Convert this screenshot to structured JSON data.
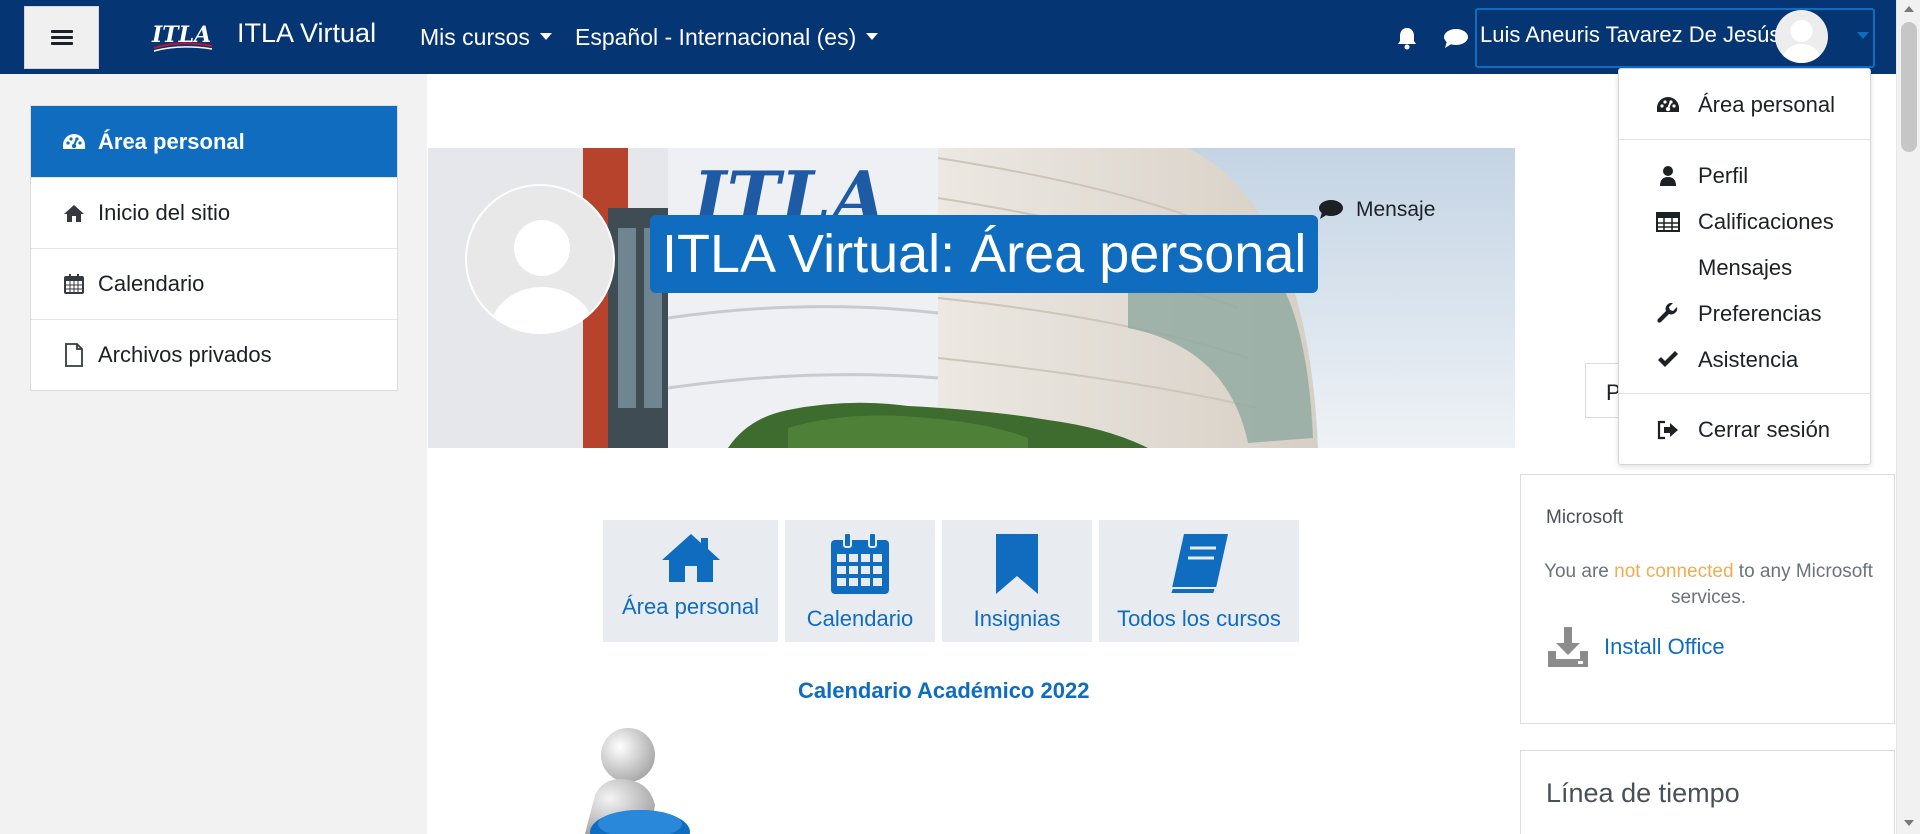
{
  "navbar": {
    "site_name": "ITLA Virtual",
    "logo_text": "ITLA",
    "menus": [
      {
        "label": "Mis cursos"
      },
      {
        "label": "Español - Internacional (es)"
      }
    ],
    "user_name": "Luis Aneuris Tavarez De Jesús",
    "icons": [
      "bars-icon",
      "bell-icon",
      "chat-icon"
    ]
  },
  "sidebar": {
    "items": [
      {
        "label": "Área personal",
        "icon": "dashboard-icon",
        "active": true
      },
      {
        "label": "Inicio del sitio",
        "icon": "home-icon",
        "active": false
      },
      {
        "label": "Calendario",
        "icon": "calendar-icon",
        "active": false
      },
      {
        "label": "Archivos privados",
        "icon": "file-icon",
        "active": false
      }
    ]
  },
  "header": {
    "title": "ITLA Virtual: Área personal",
    "message_label": "Mensaje",
    "button_partial": "P"
  },
  "tiles": [
    {
      "label": "Área personal",
      "icon": "home-icon"
    },
    {
      "label": "Calendario",
      "icon": "calendar-icon"
    },
    {
      "label": "Insignias",
      "icon": "bookmark-icon"
    },
    {
      "label": "Todos los cursos",
      "icon": "book-icon"
    }
  ],
  "content": {
    "calendar_title": "Calendario Académico 2022"
  },
  "blocks": {
    "microsoft": {
      "title": "Microsoft",
      "status_prefix": "You are ",
      "status_link": "not connected",
      "status_suffix": " to any Microsoft services.",
      "install_label": "Install Office"
    },
    "timeline": {
      "title": "Línea de tiempo"
    }
  },
  "user_dropdown": {
    "items": [
      {
        "label": "Área personal",
        "icon": "dashboard-icon"
      },
      {
        "label": "Perfil",
        "icon": "user-icon"
      },
      {
        "label": "Calificaciones",
        "icon": "table-icon"
      },
      {
        "label": "Mensajes",
        "icon": ""
      },
      {
        "label": "Preferencias",
        "icon": "wrench-icon"
      },
      {
        "label": "Asistencia",
        "icon": "check-icon"
      },
      {
        "label": "Cerrar sesión",
        "icon": "sign-out-icon"
      }
    ]
  },
  "colors": {
    "navbar": "#063573",
    "primary": "#0f6cbf",
    "drawer_bg": "#f2f2f2",
    "tile_bg": "#e8ecf1",
    "warning": "#f0ad4e"
  }
}
